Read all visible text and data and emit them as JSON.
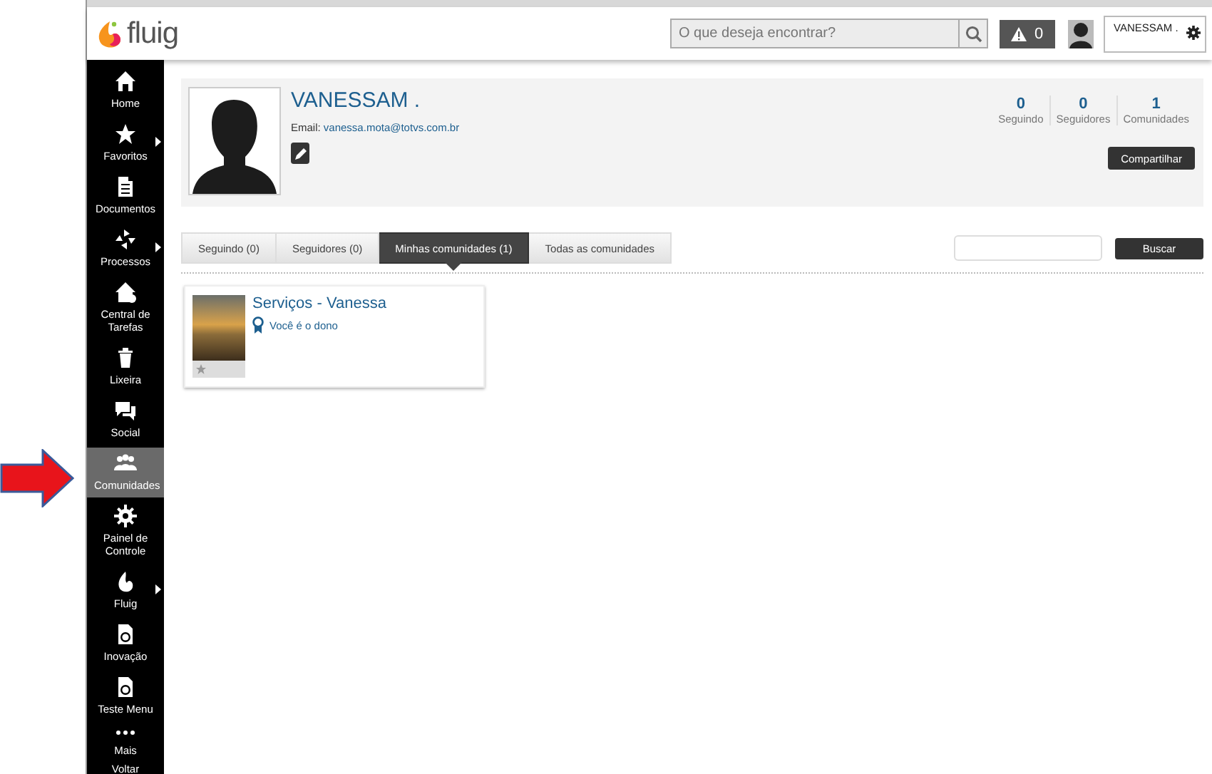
{
  "header": {
    "logo_text": "fluig",
    "search": {
      "placeholder": "O que deseja encontrar?"
    },
    "alerts_count": "0",
    "user_name": "VANESSAM ."
  },
  "sidebar": {
    "items": [
      {
        "label": "Home",
        "selected": false,
        "has_submenu": false
      },
      {
        "label": "Favoritos",
        "selected": false,
        "has_submenu": true
      },
      {
        "label": "Documentos",
        "selected": false,
        "has_submenu": false
      },
      {
        "label": "Processos",
        "selected": false,
        "has_submenu": true
      },
      {
        "label": "Central de Tarefas",
        "selected": false,
        "has_submenu": false
      },
      {
        "label": "Lixeira",
        "selected": false,
        "has_submenu": false
      },
      {
        "label": "Social",
        "selected": false,
        "has_submenu": false
      },
      {
        "label": "Comunidades",
        "selected": true,
        "has_submenu": false
      },
      {
        "label": "Painel de Controle",
        "selected": false,
        "has_submenu": false
      },
      {
        "label": "Fluig",
        "selected": false,
        "has_submenu": true
      },
      {
        "label": "Inovação",
        "selected": false,
        "has_submenu": false
      },
      {
        "label": "Teste Menu",
        "selected": false,
        "has_submenu": false
      },
      {
        "label": "Mais",
        "selected": false,
        "has_submenu": false
      },
      {
        "label": "Voltar",
        "selected": false,
        "has_submenu": false
      }
    ]
  },
  "profile": {
    "name": "VANESSAM .",
    "email_label": "Email:",
    "email": "vanessa.mota@totvs.com.br",
    "stats": [
      {
        "value": "0",
        "label": "Seguindo"
      },
      {
        "value": "0",
        "label": "Seguidores"
      },
      {
        "value": "1",
        "label": "Comunidades"
      }
    ],
    "share_button": "Compartilhar"
  },
  "tabs": [
    {
      "label": "Seguindo (0)",
      "selected": false
    },
    {
      "label": "Seguidores (0)",
      "selected": false
    },
    {
      "label": "Minhas comunidades (1)",
      "selected": true
    },
    {
      "label": "Todas as comunidades",
      "selected": false
    }
  ],
  "search": {
    "button": "Buscar"
  },
  "communities": [
    {
      "name": "Serviços - Vanessa",
      "role": "Você é o dono",
      "favorite": false
    }
  ]
}
